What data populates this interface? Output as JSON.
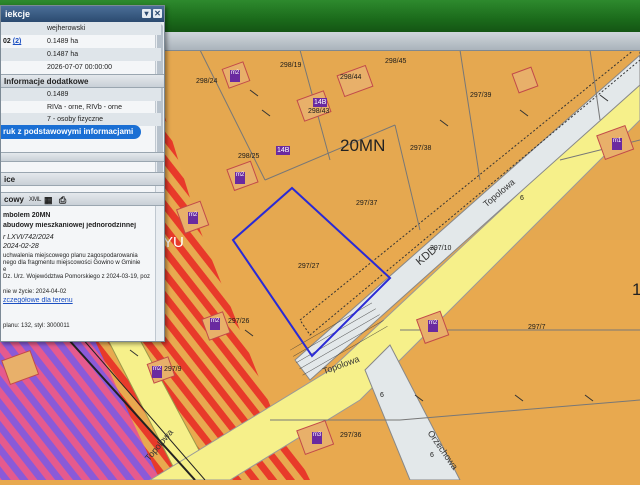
{
  "map": {
    "zone_label": "20MN",
    "zone_left": "1",
    "road_name_main": "Topolowa",
    "road_name_lower": "Topolowa",
    "road_name_left": "Topolowa",
    "road_name_bottom": "Orzechowa",
    "zone_partial": "YU",
    "road_code": "KDD",
    "parcels": {
      "p298_24": "298/24",
      "p298_19": "298/19",
      "p298_44": "298/44",
      "p298_45": "298/45",
      "p298_43": "298/43",
      "p297_39": "297/39",
      "p297_38": "297/38",
      "p298_25": "298/25",
      "p297_37": "297/37",
      "p297_10": "297/10",
      "p297_27": "297/27",
      "p297_26": "297/26",
      "p297_9": "297/9",
      "p297_7": "297/7",
      "p297_36": "297/36"
    },
    "buildings": {
      "b14b": "14B",
      "b14b_2": "14B"
    },
    "markers": {
      "m1": "m2",
      "m2": "m2",
      "m3": "m2",
      "m4": "m2",
      "m5": "m1",
      "m6": "m2",
      "m7": "m2",
      "m8": "m3"
    },
    "numbers": {
      "n6a": "6",
      "n6b": "6",
      "n6c": "6"
    }
  },
  "panel": {
    "title": "iekcje",
    "rows": [
      {
        "label": "",
        "value": "wejherowski"
      },
      {
        "label": "02",
        "value": "0.1489 ha",
        "link": "(2)"
      },
      {
        "label": "",
        "value": "0.1487 ha"
      },
      {
        "label": "",
        "value": "2026-07-07 00:00:00"
      }
    ],
    "section_dodatkowe": "Informacje dodatkowe",
    "rows2": [
      {
        "label": "",
        "value": "0.1489"
      },
      {
        "label": "",
        "value": "RIVa - orne, RIVb - orne"
      },
      {
        "label": "",
        "value": "7 - osoby fizyczne"
      }
    ],
    "print_btn": "ruk z podstawowymi informacjami",
    "section_ice": "ice",
    "section_owy": "cowy",
    "owy_ext": "XML",
    "plan": {
      "line1": "mbolem 20MN",
      "line2": "abudowy mieszkaniowej jednorodzinnej",
      "line3": "r LXVI/742/2024",
      "line4": "2024-02-28",
      "line5": "uchwalenia miejscowego planu zagospodarowania",
      "line6": "nego dla fragmentu miejscowości Gowino w Gminie",
      "line7": "e",
      "line8": "Dz. Urz. Województwa Pomorskiego z 2024-03-19, poz",
      "line9": "nie w życie: 2024-04-02",
      "line10": "zczegółowe dla terenu",
      "line11": "planu: 132, styl: 3000011"
    }
  },
  "colors": {
    "zone_orange": "#e8a94f",
    "zone_red_stripe": "#e8302a",
    "road_yellow": "#f6f08a",
    "parcel_highlight": "#2a2ad6",
    "header_green": "#1f7a1f"
  }
}
